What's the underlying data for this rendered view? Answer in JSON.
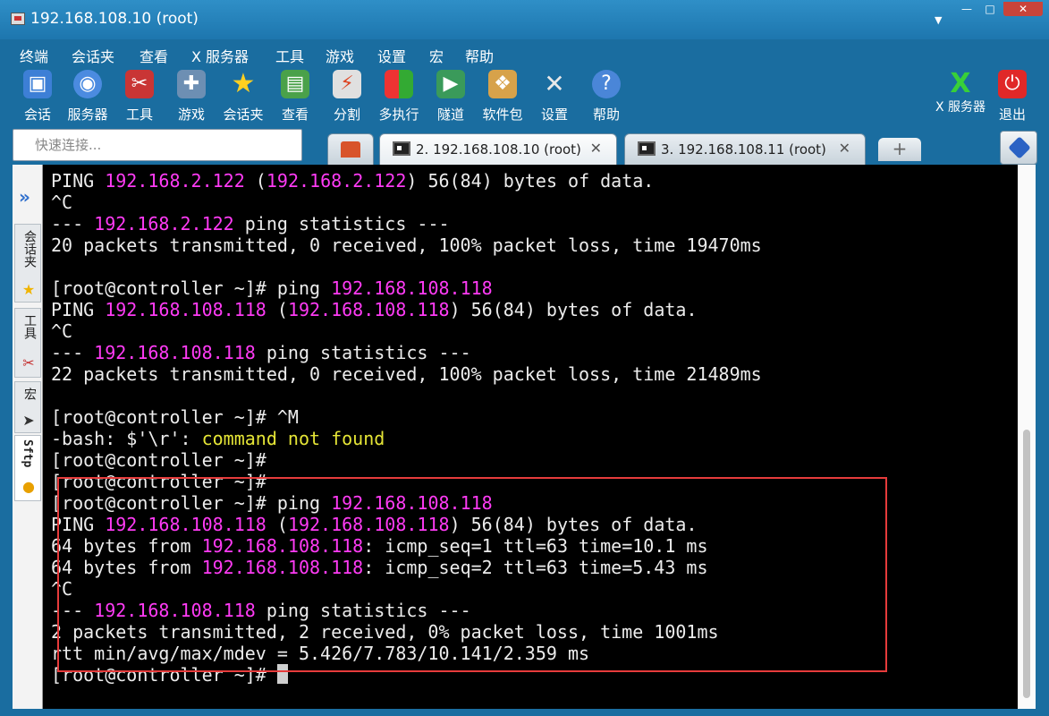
{
  "window": {
    "title": "192.168.108.10 (root)"
  },
  "window_controls": {
    "minimize": "—",
    "maximize": "□",
    "close": "✕"
  },
  "menu": [
    "终端",
    "会话夹",
    "查看",
    "X 服务器",
    "工具",
    "游戏",
    "设置",
    "宏",
    "帮助"
  ],
  "toolbar": {
    "items": [
      {
        "label": "会话",
        "icon": "sessions-icon"
      },
      {
        "label": "服务器",
        "icon": "servers-icon"
      },
      {
        "label": "工具",
        "icon": "tools-icon"
      },
      {
        "label": "游戏",
        "icon": "games-icon"
      },
      {
        "label": "会话夹",
        "icon": "star-icon"
      },
      {
        "label": "查看",
        "icon": "view-icon"
      },
      {
        "label": "分割",
        "icon": "split-icon"
      },
      {
        "label": "多执行",
        "icon": "multiexec-icon"
      },
      {
        "label": "隧道",
        "icon": "tunnel-icon"
      },
      {
        "label": "软件包",
        "icon": "packages-icon"
      },
      {
        "label": "设置",
        "icon": "settings-icon"
      },
      {
        "label": "帮助",
        "icon": "help-icon"
      }
    ],
    "xserver_label": "X 服务器",
    "exit_label": "退出"
  },
  "quick_connect": {
    "placeholder": "快速连接..."
  },
  "tabs": [
    {
      "label": "2. 192.168.108.10 (root)",
      "close": "✕",
      "active": true
    },
    {
      "label": "3. 192.168.108.11 (root)",
      "close": "✕",
      "active": false
    }
  ],
  "new_tab": "+",
  "sidebar": {
    "tabs": [
      {
        "label": "会话夹",
        "icon": "star-icon"
      },
      {
        "label": "工具",
        "icon": "tools-icon"
      },
      {
        "label": "宏",
        "icon": "macro-icon"
      },
      {
        "label": "Sftp",
        "icon": "sftp-icon"
      }
    ]
  },
  "terminal": {
    "lines": [
      [
        {
          "t": "PING "
        },
        {
          "t": "192.168.2.122",
          "c": "ip"
        },
        {
          "t": " ("
        },
        {
          "t": "192.168.2.122",
          "c": "ip"
        },
        {
          "t": ") 56(84) bytes of data."
        }
      ],
      [
        {
          "t": "^C"
        }
      ],
      [
        {
          "t": "--- "
        },
        {
          "t": "192.168.2.122",
          "c": "ip"
        },
        {
          "t": " ping statistics ---"
        }
      ],
      [
        {
          "t": "20 packets transmitted, 0 received, 100% packet loss, time 19470ms"
        }
      ],
      [
        {
          "t": ""
        }
      ],
      [
        {
          "t": "[root@controller ~]# ping "
        },
        {
          "t": "192.168.108.118",
          "c": "ip"
        }
      ],
      [
        {
          "t": "PING "
        },
        {
          "t": "192.168.108.118",
          "c": "ip"
        },
        {
          "t": " ("
        },
        {
          "t": "192.168.108.118",
          "c": "ip"
        },
        {
          "t": ") 56(84) bytes of data."
        }
      ],
      [
        {
          "t": "^C"
        }
      ],
      [
        {
          "t": "--- "
        },
        {
          "t": "192.168.108.118",
          "c": "ip"
        },
        {
          "t": " ping statistics ---"
        }
      ],
      [
        {
          "t": "22 packets transmitted, 0 received, 100% packet loss, time 21489ms"
        }
      ],
      [
        {
          "t": ""
        }
      ],
      [
        {
          "t": "[root@controller ~]# ^M"
        }
      ],
      [
        {
          "t": "-bash: $'\\r': "
        },
        {
          "t": "command not found",
          "c": "warn"
        }
      ],
      [
        {
          "t": "[root@controller ~]#"
        }
      ],
      [
        {
          "t": "[root@controller ~]#"
        }
      ],
      [
        {
          "t": "[root@controller ~]# ping "
        },
        {
          "t": "192.168.108.118",
          "c": "ip"
        }
      ],
      [
        {
          "t": "PING "
        },
        {
          "t": "192.168.108.118",
          "c": "ip"
        },
        {
          "t": " ("
        },
        {
          "t": "192.168.108.118",
          "c": "ip"
        },
        {
          "t": ") 56(84) bytes of data."
        }
      ],
      [
        {
          "t": "64 bytes from "
        },
        {
          "t": "192.168.108.118",
          "c": "ip"
        },
        {
          "t": ": icmp_seq=1 ttl=63 time=10.1 ms"
        }
      ],
      [
        {
          "t": "64 bytes from "
        },
        {
          "t": "192.168.108.118",
          "c": "ip"
        },
        {
          "t": ": icmp_seq=2 ttl=63 time=5.43 ms"
        }
      ],
      [
        {
          "t": "^C"
        }
      ],
      [
        {
          "t": "--- "
        },
        {
          "t": "192.168.108.118",
          "c": "ip"
        },
        {
          "t": " ping statistics ---"
        }
      ],
      [
        {
          "t": "2 packets transmitted, 2 received, 0% packet loss, time 1001ms"
        }
      ],
      [
        {
          "t": "rtt min/avg/max/mdev = 5.426/7.783/10.141/2.359 ms"
        }
      ],
      [
        {
          "t": "[root@controller ~]# "
        },
        {
          "t": "",
          "c": "cursor"
        }
      ]
    ]
  },
  "colors": {
    "frame": "#1a6da0",
    "ip_highlight": "#ff3bf5",
    "warning_text": "#e5e536",
    "annotation_box": "#e63b3b"
  }
}
